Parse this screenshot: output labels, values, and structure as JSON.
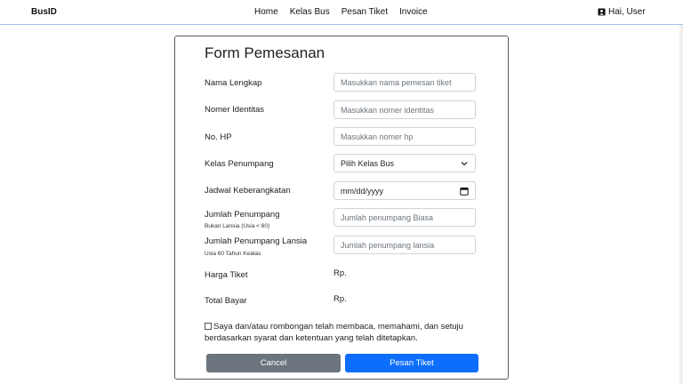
{
  "navbar": {
    "brand": "BusID",
    "links": [
      "Home",
      "Kelas Bus",
      "Pesan Tiket",
      "Invoice"
    ],
    "user_label": "Hai, User"
  },
  "form": {
    "title": "Form Pemesanan",
    "fields": {
      "nama": {
        "label": "Nama Lengkap",
        "placeholder": "Masukkan nama pemesan tiket"
      },
      "identitas": {
        "label": "Nomer Identitas",
        "placeholder": "Masukkan nomer identitas"
      },
      "hp": {
        "label": "No. HP",
        "placeholder": "Masukkan nomer hp"
      },
      "kelas": {
        "label": "Kelas Penumpang",
        "value": "Pilih Kelas Bus"
      },
      "jadwal": {
        "label": "Jadwal Keberangkatan",
        "value": "mm/dd/yyyy"
      },
      "penumpang": {
        "label": "Jumlah Penumpang",
        "sublabel": "Bukan Lansia (Usia < 60)",
        "placeholder": "Jumlah penumpang Biasa"
      },
      "lansia": {
        "label": "Jumlah Penumpang Lansia",
        "sublabel": "Usia 60 Tahun Keatas",
        "placeholder": "Jumlah penumpang lansia"
      }
    },
    "harga": {
      "label": "Harga Tiket",
      "value": "Rp."
    },
    "total": {
      "label": "Total Bayar",
      "value": "Rp."
    },
    "terms": "Saya dan/atau rombongan telah membaca, memahami, dan setuju berdasarkan syarat dan ketentuan yang telah ditetapkan.",
    "cancel_label": "Cancel",
    "submit_label": "Pesan Tiket"
  },
  "icons": {
    "user": "user-card-icon",
    "select": "chevron-down-icon",
    "date": "calendar-icon"
  },
  "colors": {
    "primary": "#0d6efd",
    "secondary": "#6c757d",
    "nav_border": "#9ec5ea"
  }
}
